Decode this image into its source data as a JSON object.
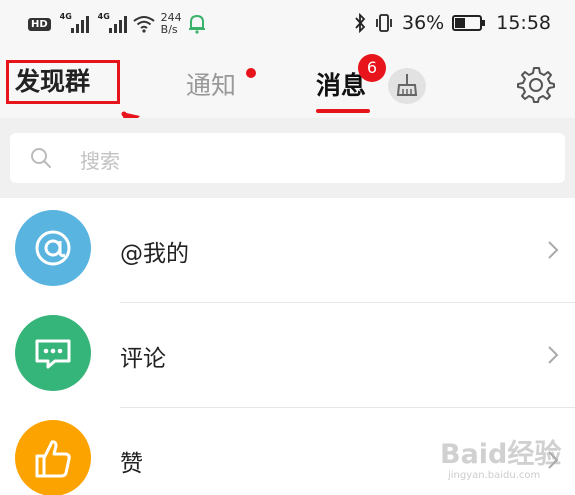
{
  "status_bar": {
    "hd": "HD",
    "signal_tag_1": "4G",
    "signal_tag_2": "4G",
    "speed_value": "244",
    "speed_unit": "B/s",
    "battery_percent": "36%",
    "battery_level": 0.36,
    "time": "15:58",
    "icons": [
      "wifi-icon",
      "notification-bell-icon",
      "bluetooth-icon",
      "vibrate-icon",
      "battery-icon"
    ]
  },
  "nav": {
    "discover_label": "发现群",
    "notify_tab": "通知",
    "message_tab": "消息",
    "message_badge": "6",
    "active_tab": "消息",
    "icons": [
      "broom-icon",
      "gear-icon"
    ]
  },
  "search": {
    "placeholder": "搜索"
  },
  "list": [
    {
      "label": "@我的",
      "icon": "at-icon",
      "color": "#5ab4e0"
    },
    {
      "label": "评论",
      "icon": "comment-icon",
      "color": "#36b57a"
    },
    {
      "label": "赞",
      "icon": "thumbs-up-icon",
      "color": "#fda300"
    }
  ],
  "watermark": {
    "brand": "Baid经验",
    "url": "jingyan.baidu.com"
  },
  "colors": {
    "accent": "#e8141b",
    "background": "#f7f7f7"
  }
}
